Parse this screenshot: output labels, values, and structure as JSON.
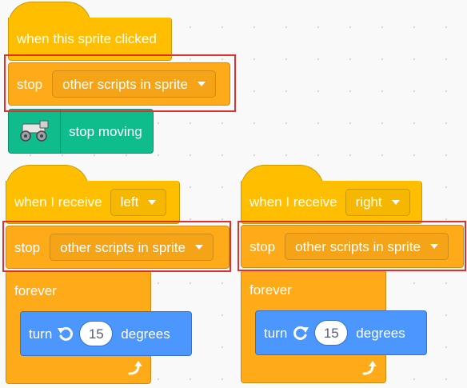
{
  "script1": {
    "hat_label": "when this sprite clicked",
    "stop_label": "stop",
    "stop_option": "other scripts in sprite",
    "ext_label": "stop moving",
    "ext_icon": "robot-car-icon"
  },
  "script2": {
    "hat_label": "when I receive",
    "message": "left",
    "stop_label": "stop",
    "stop_option": "other scripts in sprite",
    "forever_label": "forever",
    "turn_label": "turn",
    "turn_icon": "rotate-left-icon",
    "turn_value": "15",
    "degrees_label": "degrees",
    "loop_icon": "loop-arrow-icon"
  },
  "script3": {
    "hat_label": "when I receive",
    "message": "right",
    "stop_label": "stop",
    "stop_option": "other scripts in sprite",
    "forever_label": "forever",
    "turn_label": "turn",
    "turn_icon": "rotate-right-icon",
    "turn_value": "15",
    "degrees_label": "degrees",
    "loop_icon": "loop-arrow-icon"
  },
  "colors": {
    "events": "#ffbf00",
    "control": "#ffab19",
    "motion": "#4c97ff",
    "extension": "#0fbd8c",
    "highlight": "#e03131"
  }
}
